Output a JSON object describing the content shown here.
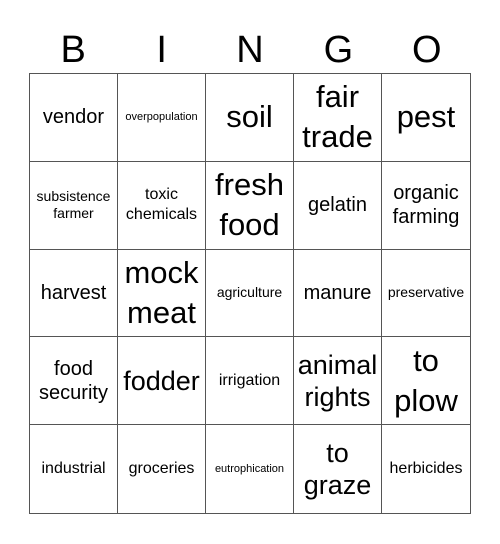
{
  "header": [
    "B",
    "I",
    "N",
    "G",
    "O"
  ],
  "cells": [
    {
      "text": "vendor",
      "size": "lg"
    },
    {
      "text": "overpopulation",
      "size": "xs"
    },
    {
      "text": "soil",
      "size": "xxl"
    },
    {
      "text": "fair trade",
      "size": "xxl"
    },
    {
      "text": "pest",
      "size": "xxl"
    },
    {
      "text": "subsistence farmer",
      "size": "sm"
    },
    {
      "text": "toxic chemicals",
      "size": "md"
    },
    {
      "text": "fresh food",
      "size": "xxl"
    },
    {
      "text": "gelatin",
      "size": "lg"
    },
    {
      "text": "organic farming",
      "size": "lg"
    },
    {
      "text": "harvest",
      "size": "lg"
    },
    {
      "text": "mock meat",
      "size": "xxl"
    },
    {
      "text": "agriculture",
      "size": "sm"
    },
    {
      "text": "manure",
      "size": "lg"
    },
    {
      "text": "preservative",
      "size": "sm"
    },
    {
      "text": "food security",
      "size": "lg"
    },
    {
      "text": "fodder",
      "size": "xl"
    },
    {
      "text": "irrigation",
      "size": "md"
    },
    {
      "text": "animal rights",
      "size": "xl"
    },
    {
      "text": "to plow",
      "size": "xxl"
    },
    {
      "text": "industrial",
      "size": "md"
    },
    {
      "text": "groceries",
      "size": "md"
    },
    {
      "text": "eutrophication",
      "size": "xs"
    },
    {
      "text": "to graze",
      "size": "xl"
    },
    {
      "text": "herbicides",
      "size": "md"
    }
  ]
}
